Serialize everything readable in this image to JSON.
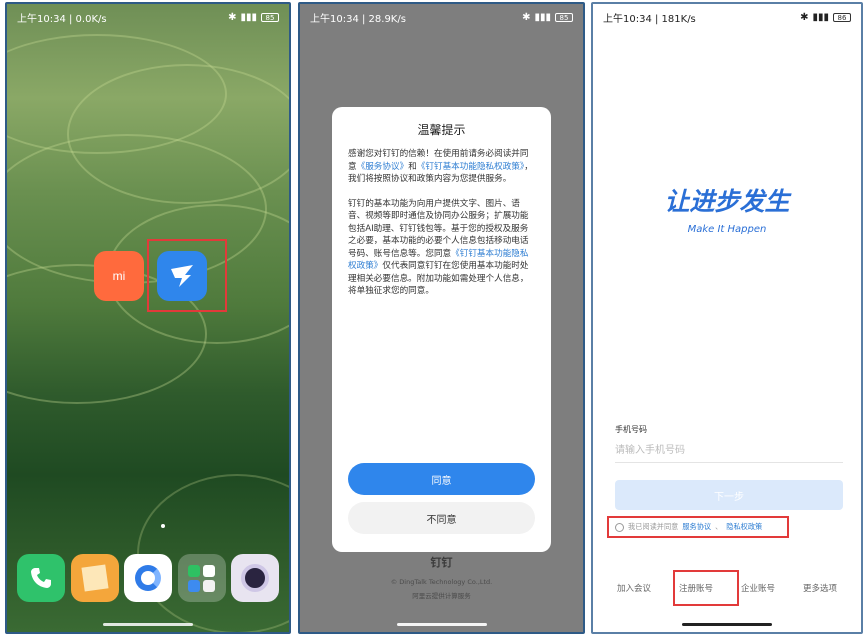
{
  "phone1": {
    "status": {
      "time": "上午10:34 | 0.0K/s",
      "battery": "85"
    },
    "apps": {
      "mi_label": "mi"
    },
    "dock": [
      "phone-app",
      "notes-app",
      "browser-app",
      "app-folder",
      "camera-app"
    ]
  },
  "phone2": {
    "status": {
      "time": "上午10:34 | 28.9K/s",
      "battery": "85"
    },
    "dialog": {
      "title": "温馨提示",
      "p1_a": "感谢您对钉钉的信赖！在使用前请务必阅读并同意",
      "p1_link1": "《服务协议》",
      "p1_and": "和",
      "p1_link2": "《钉钉基本功能隐私权政策》",
      "p1_b": "，我们将按照协议和政策内容为您提供服务。",
      "p2_a": "钉钉的基本功能为向用户提供文字、图片、语音、视频等即时通信及协同办公服务；扩展功能包括AI助理、钉钉钱包等。基于您的授权及服务之必要，基本功能的必要个人信息包括移动电话号码、账号信息等。您同意",
      "p2_link": "《钉钉基本功能隐私权政策》",
      "p2_b": "仅代表同意钉钉在您使用基本功能时处理相关必要信息。附加功能如需处理个人信息，将单独征求您的同意。",
      "agree": "同意",
      "disagree": "不同意"
    },
    "behind": {
      "logo": "钉钉",
      "copyright": "© DingTalk Technology Co.,Ltd.",
      "icp": "阿里云提供计算服务"
    }
  },
  "phone3": {
    "status": {
      "time": "上午10:34 | 181K/s",
      "battery": "86"
    },
    "slogan": "让进步发生",
    "slogan_en": "Make It Happen",
    "phone_label": "手机号码",
    "phone_placeholder": "请输入手机号码",
    "next": "下一步",
    "agree_prefix": "我已阅读并同意",
    "agree_link1": "服务协议",
    "agree_sep": "、",
    "agree_link2": "隐私权政策",
    "options": [
      "加入会议",
      "注册账号",
      "企业账号",
      "更多选项"
    ]
  },
  "colors": {
    "highlight": "#e23a3a",
    "dingtalk_blue": "#2f86ec",
    "mi_orange": "#ff6a3d"
  }
}
